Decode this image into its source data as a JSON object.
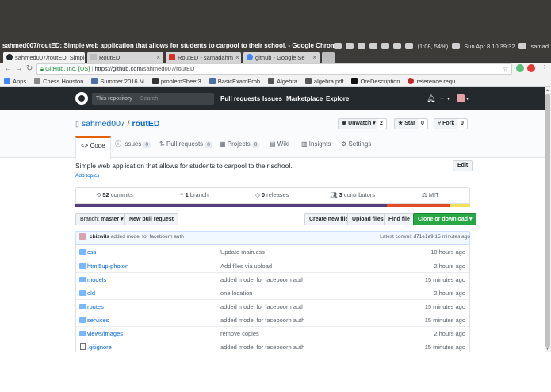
{
  "os": {
    "window_title": "sahmed007/routED: Simple web application that allows for students to carpool to their school. - Google Chrome",
    "battery": "(1:08, 54%)",
    "clock": "Sun Apr  8 10:39:32",
    "user": "samad"
  },
  "browser": {
    "tabs": [
      {
        "label": "sahmed007/routED: Simple",
        "active": true
      },
      {
        "label": "RoutED",
        "active": false
      },
      {
        "label": "RoutED - samadahm",
        "active": false
      },
      {
        "label": "github - Google Se",
        "active": false
      }
    ],
    "url_company": "GitHub, Inc. [US]",
    "url_separator": "|",
    "url_scheme_host": "https://github.com/",
    "url_path": "sahmed007/routED",
    "bookmarks": [
      {
        "label": "Apps",
        "color": "#4285f4"
      },
      {
        "label": "Chess Houston",
        "color": "#888888"
      },
      {
        "label": "Summer 2016 M",
        "color": "#4b6fa6"
      },
      {
        "label": "problemSheet3",
        "color": "#333333"
      },
      {
        "label": "BasicExamProb",
        "color": "#4b6fa6"
      },
      {
        "label": "Algebra",
        "color": "#555555"
      },
      {
        "label": "algebra.pdf",
        "color": "#555555"
      },
      {
        "label": "OreDescription",
        "color": "#111111"
      },
      {
        "label": "reference requ",
        "color": "#c62828"
      }
    ]
  },
  "github": {
    "search_scope": "This repository",
    "search_placeholder": "Search",
    "nav": [
      "Pull requests",
      "Issues",
      "Marketplace",
      "Explore"
    ],
    "plus_icon": "+",
    "bell_icon": "bell-icon"
  },
  "repo": {
    "owner": "sahmed007",
    "separator": "/",
    "name": "routED",
    "watch_label": "Unwatch",
    "watch_count": "2",
    "star_label": "Star",
    "star_count": "0",
    "fork_label": "Fork",
    "fork_count": "0",
    "tabs": [
      {
        "label": "Code",
        "count": ""
      },
      {
        "label": "Issues",
        "count": "0"
      },
      {
        "label": "Pull requests",
        "count": "0"
      },
      {
        "label": "Projects",
        "count": "0"
      },
      {
        "label": "Wiki",
        "count": ""
      },
      {
        "label": "Insights",
        "count": ""
      },
      {
        "label": "Settings",
        "count": ""
      }
    ],
    "description": "Simple web application that allows for students to carpool to their school.",
    "add_topics": "Add topics",
    "edit_label": "Edit",
    "summary": {
      "commits_num": "52",
      "commits_label": "commits",
      "branch_num": "1",
      "branch_label": "branch",
      "releases_num": "0",
      "releases_label": "releases",
      "contributors_num": "3",
      "contributors_label": "contributors",
      "license": "MIT"
    },
    "language_colors": [
      {
        "color": "#563d7c",
        "share": 0.79
      },
      {
        "color": "#e34c26",
        "share": 0.16
      },
      {
        "color": "#f1e05a",
        "share": 0.05
      }
    ],
    "branch_prefix": "Branch:",
    "branch_name": "master",
    "new_pr_label": "New pull request",
    "create_file_label": "Create new file",
    "upload_label": "Upload files",
    "find_label": "Find file",
    "clone_label": "Clone or download",
    "latest_commit": {
      "author": "chizwils",
      "message": "added model for faceboorn auth",
      "prefix": "Latest commit",
      "hash": "d71e1a9",
      "age": "15 minutes ago"
    },
    "files": [
      {
        "name": "css",
        "type": "dir",
        "message": "Update main.css",
        "age": "10 hours ago"
      },
      {
        "name": "html5up-photon",
        "type": "dir",
        "message": "Add files via upload",
        "age": "2 hours ago"
      },
      {
        "name": "models",
        "type": "dir",
        "message": "added model for faceboorn auth",
        "age": "15 minutes ago"
      },
      {
        "name": "old",
        "type": "dir",
        "message": "one location",
        "age": "2 hours ago"
      },
      {
        "name": "routes",
        "type": "dir",
        "message": "added model for faceboorn auth",
        "age": "15 minutes ago"
      },
      {
        "name": "services",
        "type": "dir",
        "message": "added model for faceboorn auth",
        "age": "15 minutes ago"
      },
      {
        "name": "views/images",
        "type": "dir",
        "message": "remove copies",
        "age": "2 hours ago"
      },
      {
        "name": ".gitignore",
        "type": "file",
        "message": "added model for faceboorn auth",
        "age": "15 minutes ago"
      }
    ]
  }
}
